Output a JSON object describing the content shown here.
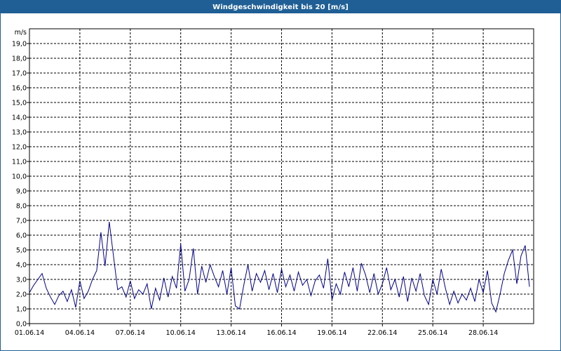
{
  "window": {
    "title": "Windgeschwindigkeit bis 20 [m/s]"
  },
  "colors": {
    "titlebar": "#1f5f95",
    "series": "#00008b",
    "grid": "#000000"
  },
  "chart_data": {
    "type": "line",
    "title": "Windgeschwindigkeit bis 20 [m/s]",
    "ylabel": "m/s",
    "xlabel": "",
    "ylim": [
      0,
      20
    ],
    "xlim": [
      "2014-06-01",
      "2014-07-01"
    ],
    "grid": true,
    "y_ticks": [
      "0,0",
      "1,0",
      "2,0",
      "3,0",
      "4,0",
      "5,0",
      "6,0",
      "7,0",
      "8,0",
      "9,0",
      "10,0",
      "11,0",
      "12,0",
      "13,0",
      "14,0",
      "15,0",
      "16,0",
      "17,0",
      "18,0",
      "19,0"
    ],
    "x_ticks": [
      {
        "date": "2014-06-01",
        "label": "01.06.14"
      },
      {
        "date": "2014-06-04",
        "label": "04.06.14"
      },
      {
        "date": "2014-06-07",
        "label": "07.06.14"
      },
      {
        "date": "2014-06-10",
        "label": "10.06.14"
      },
      {
        "date": "2014-06-13",
        "label": "13.06.14"
      },
      {
        "date": "2014-06-16",
        "label": "16.06.14"
      },
      {
        "date": "2014-06-19",
        "label": "19.06.14"
      },
      {
        "date": "2014-06-22",
        "label": "22.06.14"
      },
      {
        "date": "2014-06-25",
        "label": "25.06.14"
      },
      {
        "date": "2014-06-28",
        "label": "28.06.14"
      }
    ],
    "series": [
      {
        "points": [
          [
            "2014-06-01T00:00",
            2.1
          ],
          [
            "2014-06-01T06:00",
            2.6
          ],
          [
            "2014-06-01T12:00",
            3.0
          ],
          [
            "2014-06-01T18:00",
            3.4
          ],
          [
            "2014-06-02T00:00",
            2.4
          ],
          [
            "2014-06-02T06:00",
            1.8
          ],
          [
            "2014-06-02T12:00",
            1.3
          ],
          [
            "2014-06-02T18:00",
            1.9
          ],
          [
            "2014-06-03T00:00",
            2.2
          ],
          [
            "2014-06-03T06:00",
            1.5
          ],
          [
            "2014-06-03T12:00",
            2.3
          ],
          [
            "2014-06-03T18:00",
            1.1
          ],
          [
            "2014-06-04T00:00",
            2.9
          ],
          [
            "2014-06-04T06:00",
            1.7
          ],
          [
            "2014-06-04T12:00",
            2.2
          ],
          [
            "2014-06-04T18:00",
            3.0
          ],
          [
            "2014-06-05T00:00",
            3.6
          ],
          [
            "2014-06-05T06:00",
            6.2
          ],
          [
            "2014-06-05T12:00",
            3.9
          ],
          [
            "2014-06-05T18:00",
            6.9
          ],
          [
            "2014-06-06T00:00",
            4.6
          ],
          [
            "2014-06-06T06:00",
            2.3
          ],
          [
            "2014-06-06T12:00",
            2.5
          ],
          [
            "2014-06-06T18:00",
            1.8
          ],
          [
            "2014-06-07T00:00",
            2.9
          ],
          [
            "2014-06-07T06:00",
            1.7
          ],
          [
            "2014-06-07T12:00",
            2.3
          ],
          [
            "2014-06-07T18:00",
            2.0
          ],
          [
            "2014-06-08T00:00",
            2.7
          ],
          [
            "2014-06-08T06:00",
            1.0
          ],
          [
            "2014-06-08T12:00",
            2.4
          ],
          [
            "2014-06-08T18:00",
            1.6
          ],
          [
            "2014-06-09T00:00",
            3.1
          ],
          [
            "2014-06-09T06:00",
            1.8
          ],
          [
            "2014-06-09T12:00",
            3.2
          ],
          [
            "2014-06-09T18:00",
            2.4
          ],
          [
            "2014-06-10T00:00",
            5.4
          ],
          [
            "2014-06-10T06:00",
            2.2
          ],
          [
            "2014-06-10T12:00",
            3.0
          ],
          [
            "2014-06-10T18:00",
            5.1
          ],
          [
            "2014-06-11T00:00",
            2.0
          ],
          [
            "2014-06-11T06:00",
            3.9
          ],
          [
            "2014-06-11T12:00",
            2.8
          ],
          [
            "2014-06-11T18:00",
            4.0
          ],
          [
            "2014-06-12T00:00",
            3.2
          ],
          [
            "2014-06-12T06:00",
            2.5
          ],
          [
            "2014-06-12T12:00",
            3.6
          ],
          [
            "2014-06-12T18:00",
            2.0
          ],
          [
            "2014-06-13T00:00",
            3.8
          ],
          [
            "2014-06-13T06:00",
            1.2
          ],
          [
            "2014-06-13T12:00",
            1.0
          ],
          [
            "2014-06-13T18:00",
            2.6
          ],
          [
            "2014-06-14T00:00",
            4.0
          ],
          [
            "2014-06-14T06:00",
            2.2
          ],
          [
            "2014-06-14T12:00",
            3.4
          ],
          [
            "2014-06-14T18:00",
            2.8
          ],
          [
            "2014-06-15T00:00",
            3.6
          ],
          [
            "2014-06-15T06:00",
            2.3
          ],
          [
            "2014-06-15T12:00",
            3.4
          ],
          [
            "2014-06-15T18:00",
            2.1
          ],
          [
            "2014-06-16T00:00",
            3.7
          ],
          [
            "2014-06-16T06:00",
            2.5
          ],
          [
            "2014-06-16T12:00",
            3.3
          ],
          [
            "2014-06-16T18:00",
            2.2
          ],
          [
            "2014-06-17T00:00",
            3.5
          ],
          [
            "2014-06-17T06:00",
            2.6
          ],
          [
            "2014-06-17T12:00",
            3.0
          ],
          [
            "2014-06-17T18:00",
            1.9
          ],
          [
            "2014-06-18T00:00",
            2.9
          ],
          [
            "2014-06-18T06:00",
            3.3
          ],
          [
            "2014-06-18T12:00",
            2.4
          ],
          [
            "2014-06-18T18:00",
            4.4
          ],
          [
            "2014-06-19T00:00",
            1.6
          ],
          [
            "2014-06-19T06:00",
            2.7
          ],
          [
            "2014-06-19T12:00",
            2.0
          ],
          [
            "2014-06-19T18:00",
            3.5
          ],
          [
            "2014-06-20T00:00",
            2.5
          ],
          [
            "2014-06-20T06:00",
            3.8
          ],
          [
            "2014-06-20T12:00",
            2.2
          ],
          [
            "2014-06-20T18:00",
            4.1
          ],
          [
            "2014-06-21T00:00",
            3.3
          ],
          [
            "2014-06-21T06:00",
            2.1
          ],
          [
            "2014-06-21T12:00",
            3.4
          ],
          [
            "2014-06-21T18:00",
            2.0
          ],
          [
            "2014-06-22T00:00",
            2.7
          ],
          [
            "2014-06-22T06:00",
            3.8
          ],
          [
            "2014-06-22T12:00",
            2.3
          ],
          [
            "2014-06-22T18:00",
            3.0
          ],
          [
            "2014-06-23T00:00",
            1.8
          ],
          [
            "2014-06-23T06:00",
            3.2
          ],
          [
            "2014-06-23T12:00",
            1.5
          ],
          [
            "2014-06-23T18:00",
            3.1
          ],
          [
            "2014-06-24T00:00",
            2.2
          ],
          [
            "2014-06-24T06:00",
            3.4
          ],
          [
            "2014-06-24T12:00",
            1.9
          ],
          [
            "2014-06-24T18:00",
            1.3
          ],
          [
            "2014-06-25T00:00",
            3.0
          ],
          [
            "2014-06-25T06:00",
            2.0
          ],
          [
            "2014-06-25T12:00",
            3.7
          ],
          [
            "2014-06-25T18:00",
            2.4
          ],
          [
            "2014-06-26T00:00",
            1.3
          ],
          [
            "2014-06-26T06:00",
            2.2
          ],
          [
            "2014-06-26T12:00",
            1.4
          ],
          [
            "2014-06-26T18:00",
            2.0
          ],
          [
            "2014-06-27T00:00",
            1.6
          ],
          [
            "2014-06-27T06:00",
            2.4
          ],
          [
            "2014-06-27T12:00",
            1.5
          ],
          [
            "2014-06-27T18:00",
            3.0
          ],
          [
            "2014-06-28T00:00",
            2.1
          ],
          [
            "2014-06-28T06:00",
            3.6
          ],
          [
            "2014-06-28T12:00",
            1.4
          ],
          [
            "2014-06-28T18:00",
            0.8
          ],
          [
            "2014-06-29T00:00",
            2.0
          ],
          [
            "2014-06-29T06:00",
            3.4
          ],
          [
            "2014-06-29T12:00",
            4.3
          ],
          [
            "2014-06-29T18:00",
            5.0
          ],
          [
            "2014-06-30T00:00",
            2.7
          ],
          [
            "2014-06-30T06:00",
            4.6
          ],
          [
            "2014-06-30T12:00",
            5.3
          ],
          [
            "2014-06-30T18:00",
            2.5
          ]
        ]
      }
    ]
  }
}
